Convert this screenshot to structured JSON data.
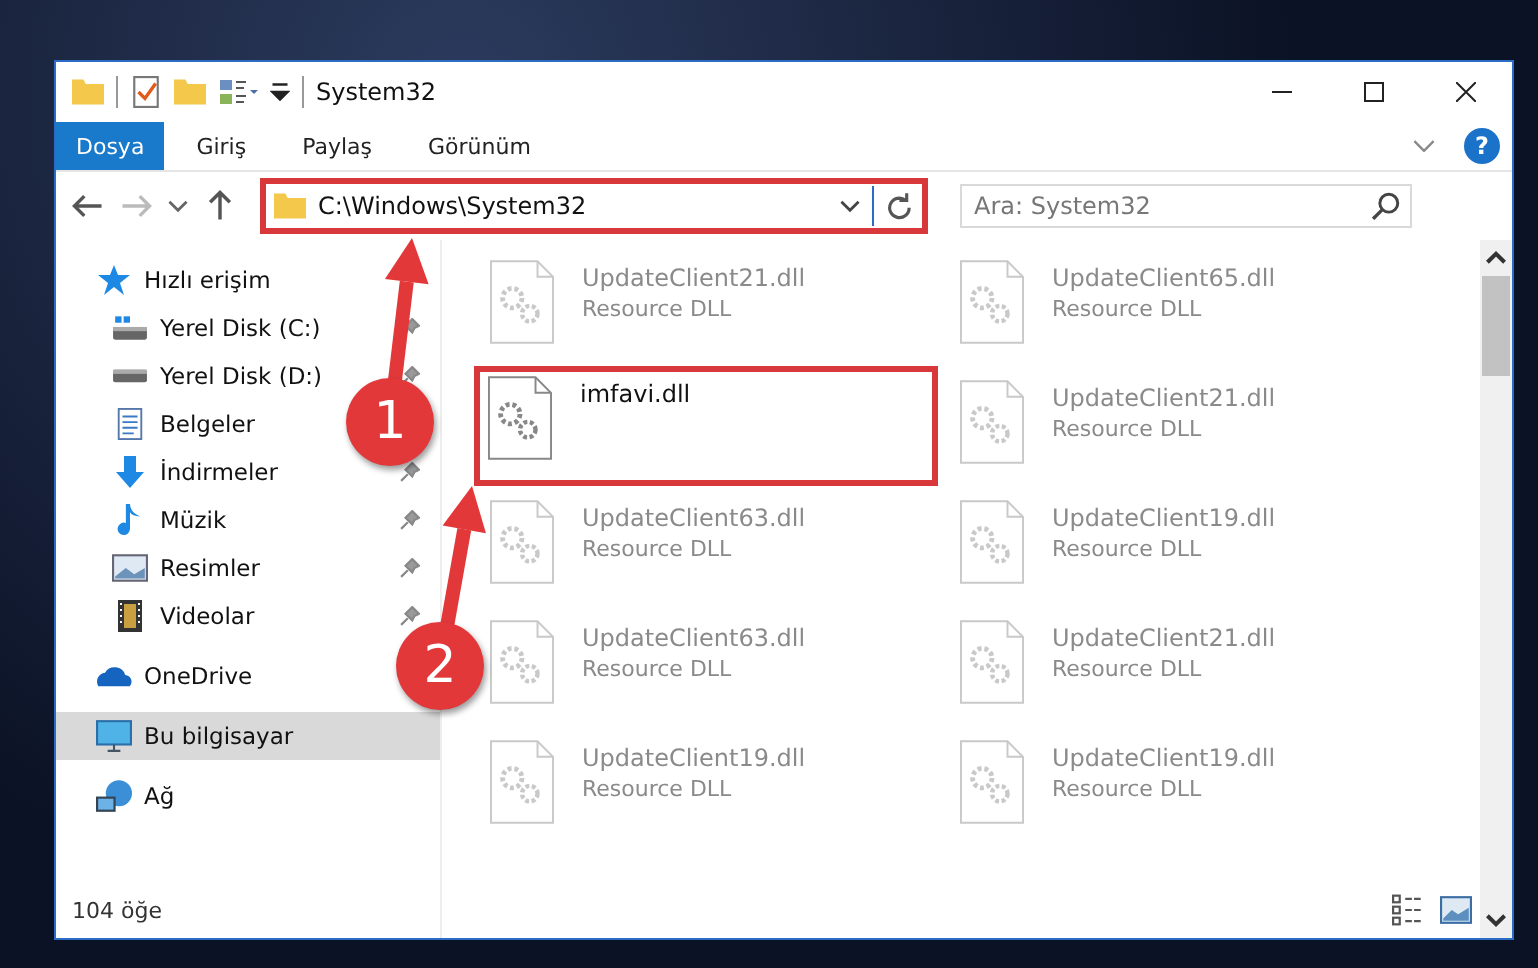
{
  "window": {
    "title": "System32"
  },
  "ribbon_tabs": [
    {
      "label": "Dosya",
      "selected": true
    },
    {
      "label": "Giriş",
      "selected": false
    },
    {
      "label": "Paylaş",
      "selected": false
    },
    {
      "label": "Görünüm",
      "selected": false
    }
  ],
  "help_button": {
    "label": "?"
  },
  "address": {
    "path": "C:\\Windows\\System32",
    "highlighted": true
  },
  "search": {
    "placeholder": "Ara: System32"
  },
  "sidebar": {
    "items": [
      {
        "label": "Hızlı erişim",
        "kind": "star",
        "pinned": false,
        "selected": false,
        "children": [
          {
            "label": "Yerel Disk (C:)",
            "kind": "windrive",
            "pinned": true,
            "selected": false
          },
          {
            "label": "Yerel Disk (D:)",
            "kind": "drive",
            "pinned": true,
            "selected": false
          },
          {
            "label": "Belgeler",
            "kind": "document",
            "pinned": false,
            "selected": false
          },
          {
            "label": "İndirmeler",
            "kind": "download",
            "pinned": true,
            "selected": false
          },
          {
            "label": "Müzik",
            "kind": "music",
            "pinned": true,
            "selected": false
          },
          {
            "label": "Resimler",
            "kind": "picture",
            "pinned": true,
            "selected": false
          },
          {
            "label": "Videolar",
            "kind": "film",
            "pinned": true,
            "selected": false
          }
        ]
      },
      {
        "label": "OneDrive",
        "kind": "cloud",
        "pinned": false,
        "selected": false
      },
      {
        "label": "Bu bilgisayar",
        "kind": "computer",
        "pinned": false,
        "selected": true
      },
      {
        "label": "Ağ",
        "kind": "network",
        "pinned": false,
        "selected": false
      }
    ]
  },
  "files": [
    {
      "name": "UpdateClient21.dll",
      "type": "Resource DLL",
      "blurred": true,
      "highlighted": false
    },
    {
      "name": "UpdateClient65.dll",
      "type": "Resource DLL",
      "blurred": true,
      "highlighted": false
    },
    {
      "name": "imfavi.dll",
      "blurred": false,
      "highlighted": true
    },
    {
      "name": "UpdateClient21.dll",
      "type": "Resource DLL",
      "blurred": true,
      "highlighted": false
    },
    {
      "name": "UpdateClient63.dll",
      "type": "Resource DLL",
      "blurred": true,
      "highlighted": false
    },
    {
      "name": "UpdateClient19.dll",
      "type": "Resource DLL",
      "blurred": true,
      "highlighted": false
    },
    {
      "name": "UpdateClient63.dll",
      "type": "Resource DLL",
      "blurred": true,
      "highlighted": false
    },
    {
      "name": "UpdateClient21.dll",
      "type": "Resource DLL",
      "blurred": true,
      "highlighted": false
    },
    {
      "name": "UpdateClient19.dll",
      "type": "Resource DLL",
      "blurred": true,
      "highlighted": false
    },
    {
      "name": "UpdateClient19.dll",
      "type": "Resource DLL",
      "blurred": true,
      "highlighted": false
    }
  ],
  "status_bar": {
    "count": "104 öğe"
  },
  "annotations": [
    {
      "number": "1"
    },
    {
      "number": "2"
    }
  ]
}
